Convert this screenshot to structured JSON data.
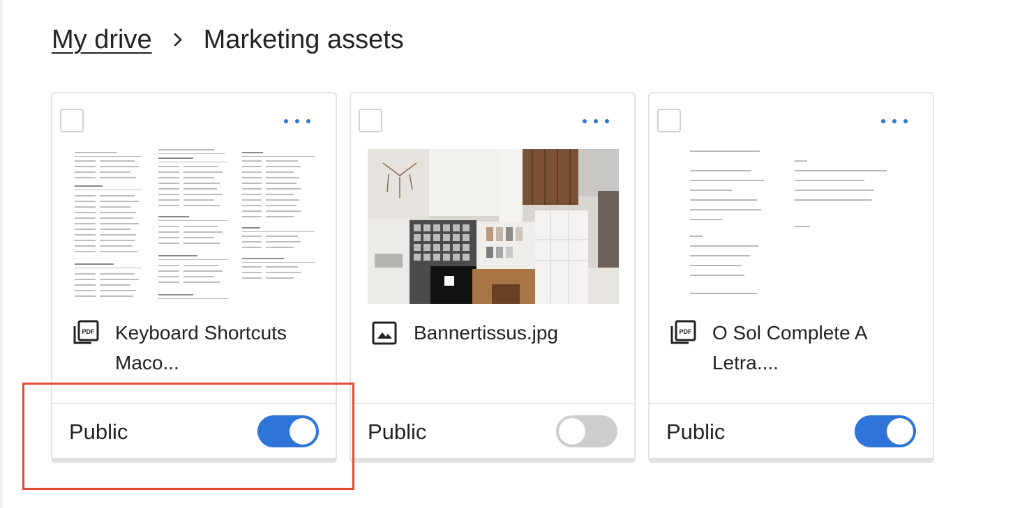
{
  "breadcrumb": {
    "root": "My drive",
    "current": "Marketing assets"
  },
  "icons": {
    "separator": "chevron-right-icon",
    "pdf": "pdf-file-icon",
    "image": "image-file-icon",
    "more": "more-horizontal-icon"
  },
  "colors": {
    "accent": "#2f74d8",
    "toggle_off": "#cdcdcd",
    "highlight": "#e24a33"
  },
  "files": [
    {
      "name": "Keyboard Shortcuts Maco...",
      "type": "pdf",
      "visibility_label": "Public",
      "public": true,
      "selected": false
    },
    {
      "name": "Bannertissus.jpg",
      "type": "image",
      "visibility_label": "Public",
      "public": false,
      "selected": false
    },
    {
      "name": "O Sol Complete A Letra....",
      "type": "pdf",
      "visibility_label": "Public",
      "public": true,
      "selected": false
    }
  ]
}
